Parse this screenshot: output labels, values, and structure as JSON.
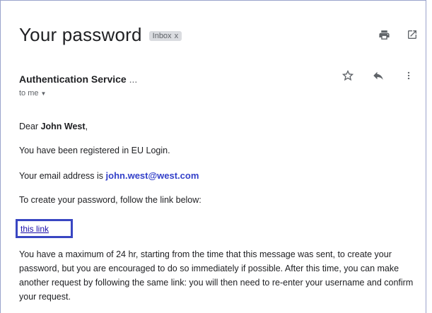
{
  "email": {
    "subject": "Your password",
    "label": "Inbox",
    "label_close": "x",
    "sender": "Authentication Service",
    "sender_ellipsis": "...",
    "recipient": "to me",
    "body": {
      "greeting_prefix": "Dear ",
      "greeting_name": "John West",
      "greeting_suffix": ",",
      "line1": "You have been registered in EU Login.",
      "line2_prefix": "Your email address is ",
      "line2_email": "john.west@west.com",
      "line3": "To create your password, follow the link below:",
      "link_text": "this link",
      "paragraph": "You have a maximum of 24 hr, starting from the time that this message was sent, to create your password, but you are encouraged to do so immediately if possible. After this time, you can make another request by following the same link: you will then need to re-enter your username and confirm your request."
    }
  },
  "icons": {
    "print": "print-icon",
    "open_new_window": "open-in-new-window-icon",
    "star": "star-icon",
    "reply": "reply-icon",
    "more": "more-vertical-icon",
    "dropdown": "chevron-down-icon"
  },
  "colors": {
    "highlight_border": "#3946c2",
    "email_link": "#3340c9",
    "link": "#1a0dab"
  }
}
